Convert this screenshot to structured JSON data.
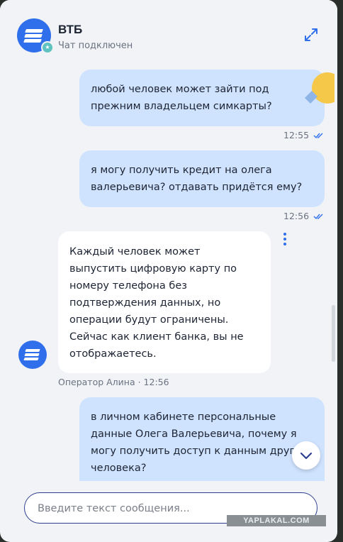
{
  "header": {
    "title": "ВТБ",
    "status": "Чат подключен"
  },
  "messages": [
    {
      "type": "outgoing",
      "text": "любой человек может зайти под прежним владельцем симкарты?",
      "time": "12:55",
      "read": true
    },
    {
      "type": "outgoing",
      "text": "я могу получить кредит на олега валерьевича? отдавать придётся ему?",
      "time": "12:56",
      "read": true
    },
    {
      "type": "incoming",
      "text": "Каждый человек может выпустить цифровую карту по номеру телефона без подтверждения данных, но операции будут ограничены. Сейчас как клиент банка, вы не отображаетесь.",
      "author_time": "Оператор Алина · 12:56"
    },
    {
      "type": "outgoing",
      "text": "в личном кабинете персональные данные Олега Валерьевича, почему я могу получить доступ к данным другого человека?"
    }
  ],
  "composer": {
    "placeholder": "Введите текст сообщения...",
    "value": ""
  },
  "watermark": "YAPLAKAL.COM",
  "colors": {
    "accent": "#2f6fec",
    "outgoing_bubble": "#cfe3ff",
    "incoming_bubble": "#ffffff",
    "panel_bg": "#f1f3f7",
    "read_check": "#2f6fec"
  },
  "icons": [
    "vtb-logo-icon",
    "online-status-icon",
    "expand-icon",
    "double-check-icon",
    "more-vertical-icon",
    "chevron-down-icon",
    "sticker-icon"
  ]
}
